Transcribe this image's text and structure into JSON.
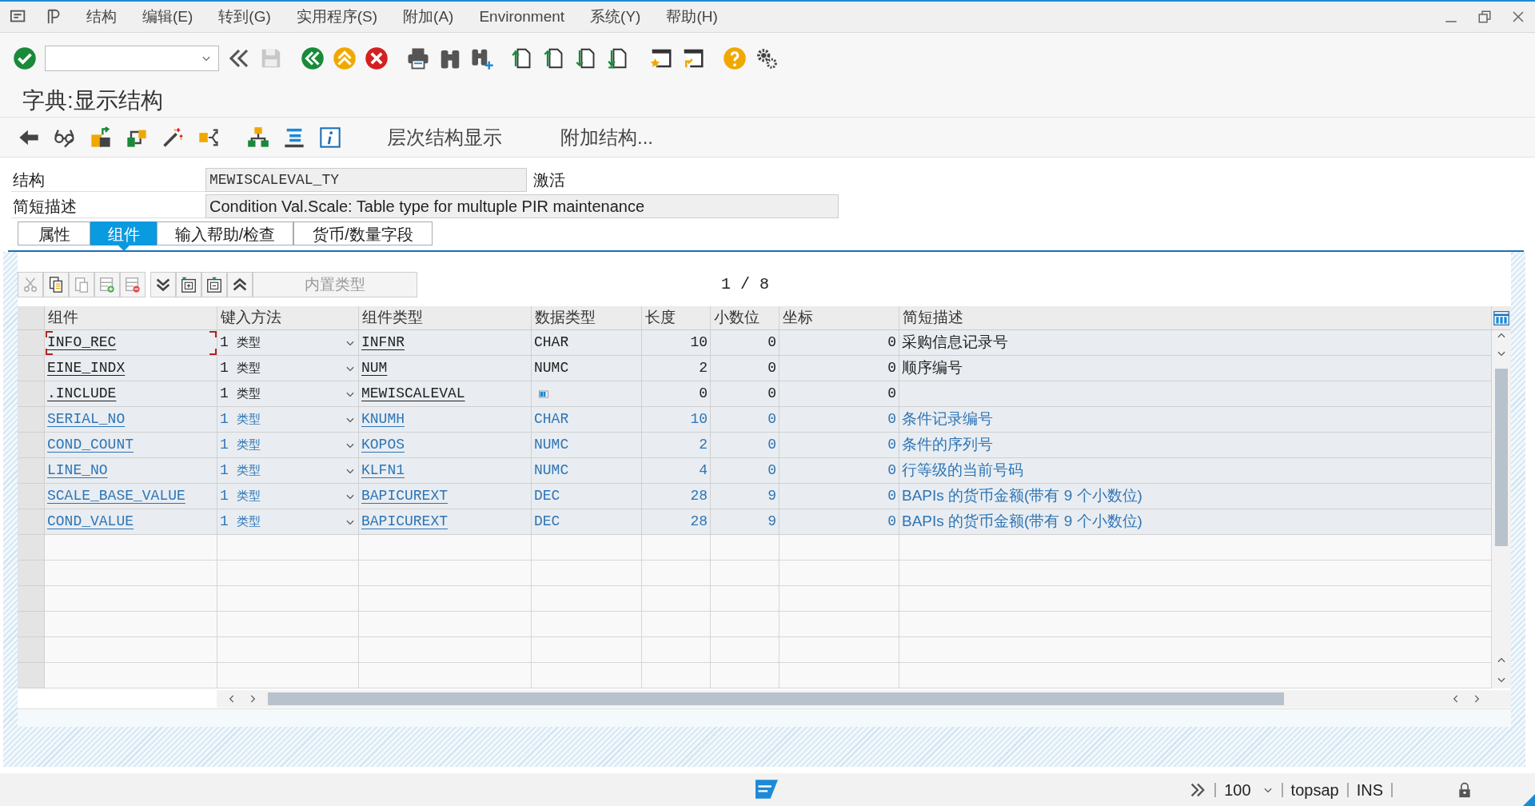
{
  "menu": [
    "结构",
    "编辑(E)",
    "转到(G)",
    "实用程序(S)",
    "附加(A)",
    "Environment",
    "系统(Y)",
    "帮助(H)"
  ],
  "title": "字典:显示结构",
  "app_toolbar": {
    "buttons": [
      "层次结构显示",
      "附加结构..."
    ]
  },
  "structure": {
    "label": "结构",
    "value": "MEWISCALEVAL_TY",
    "status": "激活"
  },
  "short_description": {
    "label": "简短描述",
    "value": "Condition Val.Scale: Table type for multuple PIR maintenance"
  },
  "tabs": [
    {
      "label": "属性",
      "selected": false
    },
    {
      "label": "组件",
      "selected": true
    },
    {
      "label": "输入帮助/检查",
      "selected": false
    },
    {
      "label": "货币/数量字段",
      "selected": false
    }
  ],
  "table_toolbar": {
    "builtin_type_button": "内置类型",
    "position": "1 / 8"
  },
  "table": {
    "columns": [
      "组件",
      "键入方法",
      "组件类型",
      "数据类型",
      "长度",
      "小数位",
      "坐标",
      "简短描述"
    ],
    "rows": [
      {
        "kind": "field",
        "focused": true,
        "name": "INFO_REC",
        "entry_method": "1",
        "entry_type": "类型",
        "component_type": "INFNR",
        "data_type": "CHAR",
        "length": "10",
        "decimals": "0",
        "coordinate": "0",
        "description": "采购信息记录号"
      },
      {
        "kind": "field",
        "focused": false,
        "name": "EINE_INDX",
        "entry_method": "1",
        "entry_type": "类型",
        "component_type": "NUM",
        "data_type": "NUMC",
        "length": "2",
        "decimals": "0",
        "coordinate": "0",
        "description": "顺序编号"
      },
      {
        "kind": "include",
        "focused": false,
        "name": ".INCLUDE",
        "entry_method": "1",
        "entry_type": "类型",
        "component_type": "MEWISCALEVAL",
        "length": "0",
        "decimals": "0",
        "coordinate": "0"
      },
      {
        "kind": "included",
        "focused": false,
        "name": "SERIAL_NO",
        "entry_method": "1",
        "entry_type": "类型",
        "component_type": "KNUMH",
        "data_type": "CHAR",
        "length": "10",
        "decimals": "0",
        "coordinate": "0",
        "description": "条件记录编号"
      },
      {
        "kind": "included",
        "focused": false,
        "name": "COND_COUNT",
        "entry_method": "1",
        "entry_type": "类型",
        "component_type": "KOPOS",
        "data_type": "NUMC",
        "length": "2",
        "decimals": "0",
        "coordinate": "0",
        "description": "条件的序列号"
      },
      {
        "kind": "included",
        "focused": false,
        "name": "LINE_NO",
        "entry_method": "1",
        "entry_type": "类型",
        "component_type": "KLFN1",
        "data_type": "NUMC",
        "length": "4",
        "decimals": "0",
        "coordinate": "0",
        "description": "行等级的当前号码"
      },
      {
        "kind": "included",
        "focused": false,
        "name": "SCALE_BASE_VALUE",
        "entry_method": "1",
        "entry_type": "类型",
        "component_type": "BAPICUREXT",
        "data_type": "DEC",
        "length": "28",
        "decimals": "9",
        "coordinate": "0",
        "description": "BAPIs 的货币金额(带有 9 个小数位)"
      },
      {
        "kind": "included",
        "focused": false,
        "name": "COND_VALUE",
        "entry_method": "1",
        "entry_type": "类型",
        "component_type": "BAPICUREXT",
        "data_type": "DEC",
        "length": "28",
        "decimals": "9",
        "coordinate": "0",
        "description": "BAPIs 的货币金额(带有 9 个小数位)"
      }
    ]
  },
  "status_bar": {
    "zoom": "100",
    "system": "topsap",
    "mode": "INS"
  }
}
